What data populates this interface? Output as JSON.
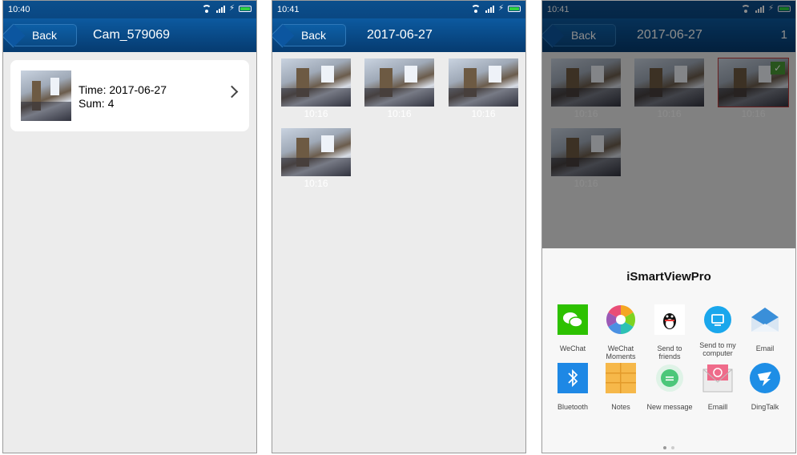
{
  "screen1": {
    "status_time": "10:40",
    "back_label": "Back",
    "title": "Cam_579069",
    "card": {
      "time_label": "Time:",
      "time_value": "2017-06-27",
      "sum_label": "Sum:",
      "sum_value": "4"
    }
  },
  "screen2": {
    "status_time": "10:41",
    "back_label": "Back",
    "title": "2017-06-27",
    "thumbnails": [
      {
        "caption": "10:16"
      },
      {
        "caption": "10:16"
      },
      {
        "caption": "10:16"
      },
      {
        "caption": "10:16"
      }
    ]
  },
  "screen3": {
    "status_time": "10:41",
    "back_label": "Back",
    "title": "2017-06-27",
    "selected_count": "1",
    "thumbnails": [
      {
        "caption": "10:16",
        "selected": false
      },
      {
        "caption": "10:16",
        "selected": false
      },
      {
        "caption": "10:16",
        "selected": true
      },
      {
        "caption": "10:16",
        "selected": false
      }
    ],
    "share_sheet": {
      "title": "iSmartViewPro",
      "items": [
        {
          "label": "WeChat",
          "icon": "wechat-icon",
          "color": "#2dc100"
        },
        {
          "label": "WeChat Moments",
          "icon": "moments-icon",
          "color": "#f5a623"
        },
        {
          "label": "Send to friends",
          "icon": "qq-icon",
          "color": "#111111"
        },
        {
          "label": "Send to my computer",
          "icon": "computer-icon",
          "color": "#1aa7ec"
        },
        {
          "label": "Email",
          "icon": "email-icon",
          "color": "#3a8fd9"
        },
        {
          "label": "Bluetooth",
          "icon": "bluetooth-icon",
          "color": "#1e88e5"
        },
        {
          "label": "Notes",
          "icon": "notes-icon",
          "color": "#f6b84a"
        },
        {
          "label": "New message",
          "icon": "message-icon",
          "color": "#4cc77a"
        },
        {
          "label": "Emaill",
          "icon": "mail-envelope-icon",
          "color": "#ef6b8a"
        },
        {
          "label": "DingTalk",
          "icon": "dingtalk-icon",
          "color": "#1e8ee6"
        }
      ]
    }
  },
  "colors": {
    "nav_bar": "#0a4a85",
    "battery": "#2fd13f",
    "selected_check": "#4a9a35"
  }
}
